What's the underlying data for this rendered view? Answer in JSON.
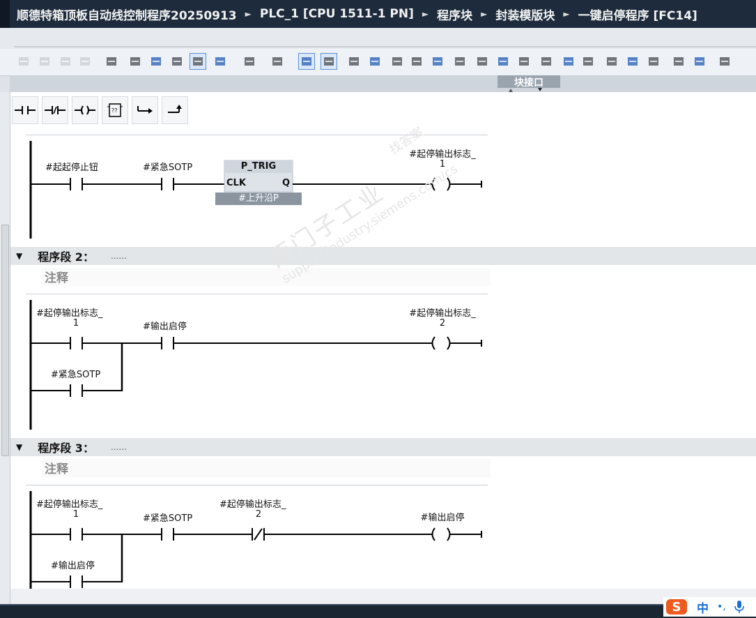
{
  "breadcrumb": [
    "顺德特箱顶板自动线控制程序20250913",
    "PLC_1 [CPU 1511-1 PN]",
    "程序块",
    "封装模版块",
    "一键启停程序 [FC14]"
  ],
  "interface_band": {
    "label": "块接口"
  },
  "toolbar": {
    "icons": [
      "insert-network-icon",
      "delete-network-icon",
      "insert-row-icon",
      "append-row-icon",
      "absolute-operand-icon",
      "navigation-icon",
      "favorites-icon",
      "network-comments-icon",
      "comment-icon",
      "expand-networks-icon",
      "collapse-networks-icon",
      "display-tags-icon",
      "show-tag-info-icon",
      "favorites-star-icon",
      "go-to-previous-error-icon",
      "go-to-next-error-icon",
      "update-calls-icon",
      "update-block-icon",
      "compare-icon",
      "monitor-icon",
      "jump-back-icon",
      "indent-increase-icon",
      "indent-decrease-icon",
      "goto-icon",
      "list-icon",
      "split-icon",
      "bookmark-icon",
      "previous-bookmark-icon",
      "next-bookmark-icon",
      "search-icon",
      "watch-glasses-icon",
      "database-icon"
    ]
  },
  "palette": {
    "items": [
      "normally-open-contact-icon",
      "normally-closed-contact-icon",
      "coil-icon",
      "empty-box-icon",
      "open-branch-icon",
      "close-branch-icon"
    ],
    "empty_box_label": "??"
  },
  "networks": [
    {
      "id": 1,
      "contacts": [
        {
          "label": "#起起停止钮",
          "type": "NO"
        },
        {
          "label": "#紧急SOTP",
          "type": "NO"
        }
      ],
      "box": {
        "name": "P_TRIG",
        "pin_in": "CLK",
        "pin_out": "Q",
        "instance": "#上升沿P"
      },
      "coil": {
        "label_line1": "#起停输出标志_",
        "label_line2": "1"
      }
    },
    {
      "id": 2,
      "header": "程序段 2：",
      "dots": "......",
      "comment": "注释",
      "contacts": [
        {
          "label_line1": "#起停输出标志_",
          "label_line2": "1",
          "type": "NO"
        },
        {
          "label": "#输出启停",
          "type": "NO"
        }
      ],
      "parallel": {
        "label": "#紧急SOTP",
        "type": "NO"
      },
      "coil": {
        "label_line1": "#起停输出标志_",
        "label_line2": "2"
      }
    },
    {
      "id": 3,
      "header": "程序段 3：",
      "dots": "......",
      "comment": "注释",
      "contacts": [
        {
          "label_line1": "#起停输出标志_",
          "label_line2": "1",
          "type": "NO"
        },
        {
          "label": "#紧急SOTP",
          "type": "NO"
        },
        {
          "label_line1": "#起停输出标志_",
          "label_line2": "2",
          "type": "NC"
        }
      ],
      "parallel": {
        "label": "#输出启停",
        "type": "NO"
      },
      "coil": {
        "label": "#输出启停"
      }
    }
  ],
  "watermark": {
    "line1": "西门子工业",
    "line2": "找答案",
    "line3": "support.industry.siemens.com/cs"
  },
  "ime": {
    "logo": "S",
    "mode": "中",
    "punct": "•,",
    "mic": "microphone-icon"
  },
  "colors": {
    "title_bg": "#1d2b3c",
    "ime_logo": "#ef5a1e",
    "ime_text": "#1a6fd6"
  }
}
